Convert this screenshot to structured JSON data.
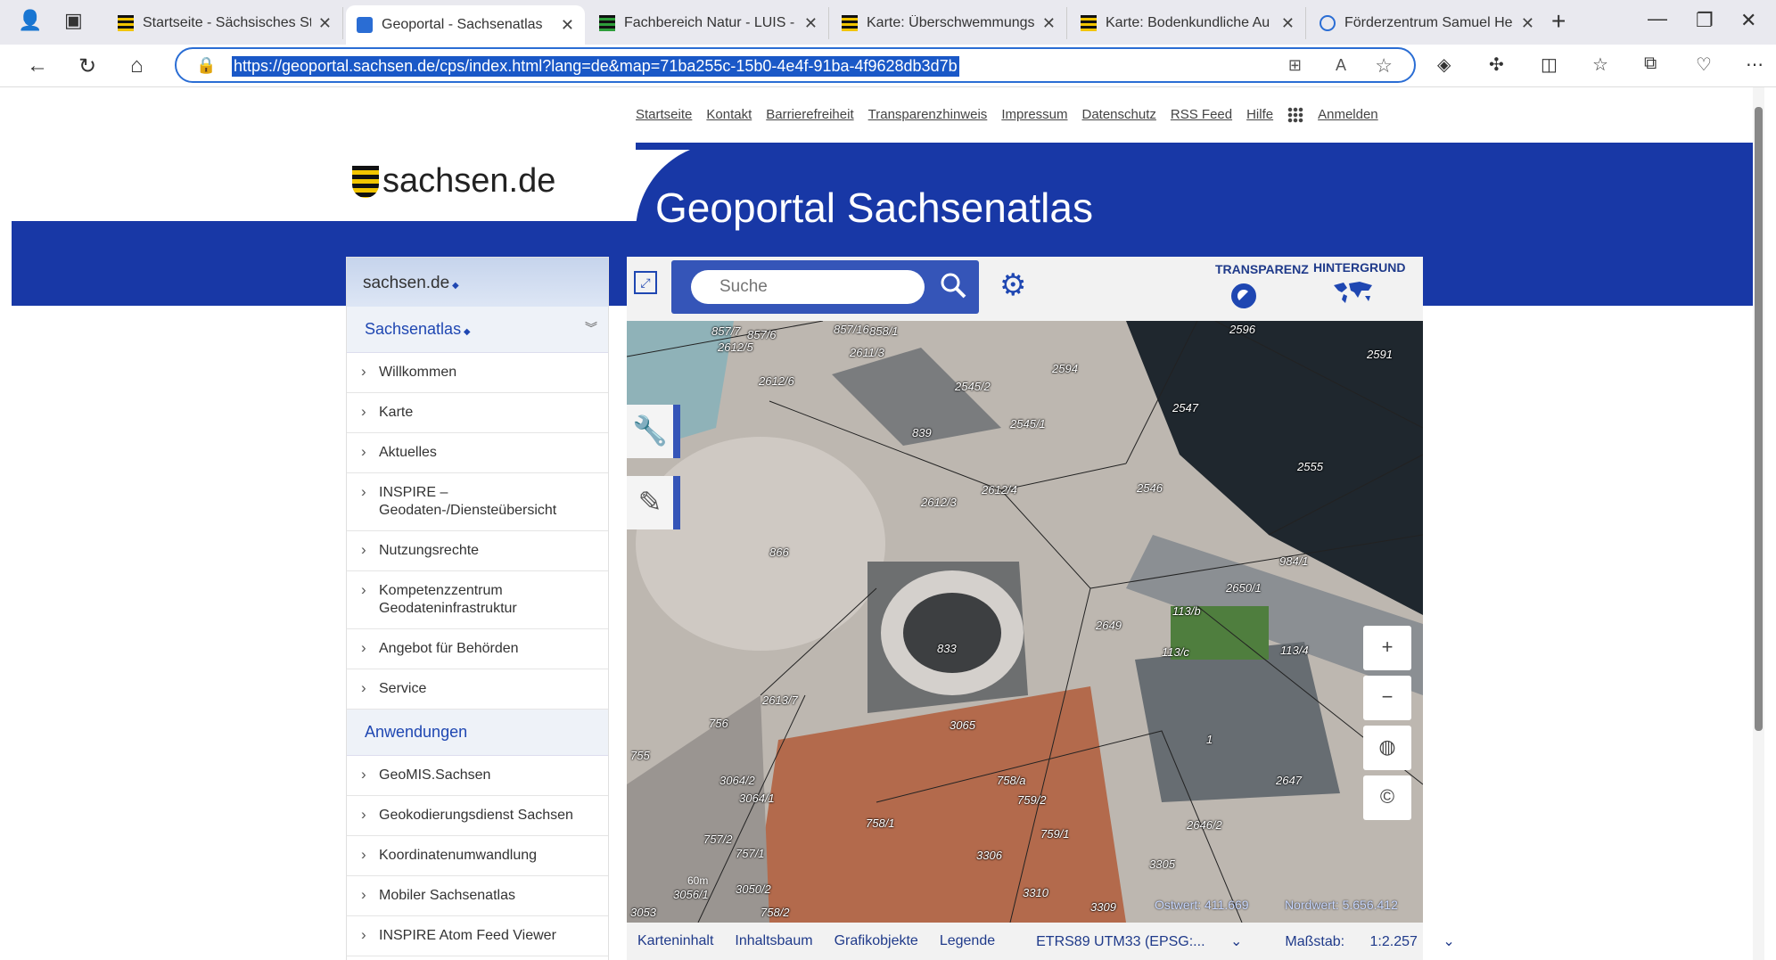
{
  "browser": {
    "tabs": [
      {
        "label": "Startseite - Sächsisches Sta",
        "active": false
      },
      {
        "label": "Geoportal - Sachsenatlas",
        "active": true
      },
      {
        "label": "Fachbereich Natur - LUIS -",
        "active": false
      },
      {
        "label": "Karte: Überschwemmungs",
        "active": false
      },
      {
        "label": "Karte: Bodenkundliche Au",
        "active": false
      },
      {
        "label": "Förderzentrum Samuel He",
        "active": false
      }
    ],
    "url": "https://geoportal.sachsen.de/cps/index.html?lang=de&map=71ba255c-15b0-4e4f-91ba-4f9628db3d7b"
  },
  "topnav": [
    "Startseite",
    "Kontakt",
    "Barrierefreiheit",
    "Transparenzhinweis",
    "Impressum",
    "Datenschutz",
    "RSS Feed",
    "Hilfe",
    "Anmelden"
  ],
  "header": {
    "logo_text": "sachsen.de",
    "title": "Geoportal Sachsenatlas"
  },
  "sidebar": {
    "top_label": "sachsen.de",
    "atlas_label": "Sachsenatlas",
    "items": [
      "Willkommen",
      "Karte",
      "Aktuelles",
      "INSPIRE – Geodaten-/Diensteübersicht",
      "Nutzungsrechte",
      "Kompetenzzentrum Geodateninfrastruktur",
      "Angebot für Behörden",
      "Service"
    ],
    "section2_label": "Anwendungen",
    "items2": [
      "GeoMIS.Sachsen",
      "Geokodierungsdienst Sachsen",
      "Koordinatenumwandlung",
      "Mobiler Sachsenatlas",
      "INSPIRE Atom Feed Viewer"
    ]
  },
  "map_toolbar": {
    "search_placeholder": "Suche",
    "transparency_label": "TRANSPARENZ",
    "background_label": "HINTERGRUND"
  },
  "map": {
    "parcel_labels": [
      "857/7",
      "857/6",
      "857/16",
      "858/1",
      "2612/5",
      "2611/3",
      "2612/6",
      "2596",
      "2591",
      "2594",
      "2545/2",
      "2545/1",
      "2547",
      "839",
      "2612/4",
      "2612/3",
      "2546",
      "2555",
      "984/1",
      "866",
      "2650/1",
      "2649",
      "113/b",
      "113/4",
      "113/c",
      "833",
      "2613/7",
      "3065",
      "756",
      "755",
      "3064/2",
      "3064/1",
      "757/2",
      "757/1",
      "758/a",
      "758/1",
      "759/2",
      "759/1",
      "2646/2",
      "3305",
      "3306",
      "3309",
      "3310",
      "3050/2",
      "758/2",
      "3056/1",
      "1",
      "2647",
      "3053"
    ],
    "scale_bar": "60m",
    "ostwert": "Ostwert: 411.669",
    "nordwert": "Nordwert: 5.656.412"
  },
  "map_footer": {
    "items": [
      "Karteninhalt",
      "Inhaltsbaum",
      "Grafikobjekte",
      "Legende"
    ],
    "crs": "ETRS89 UTM33 (EPSG:...",
    "scale_label": "Maßstab:",
    "scale_value": "1:2.257"
  }
}
